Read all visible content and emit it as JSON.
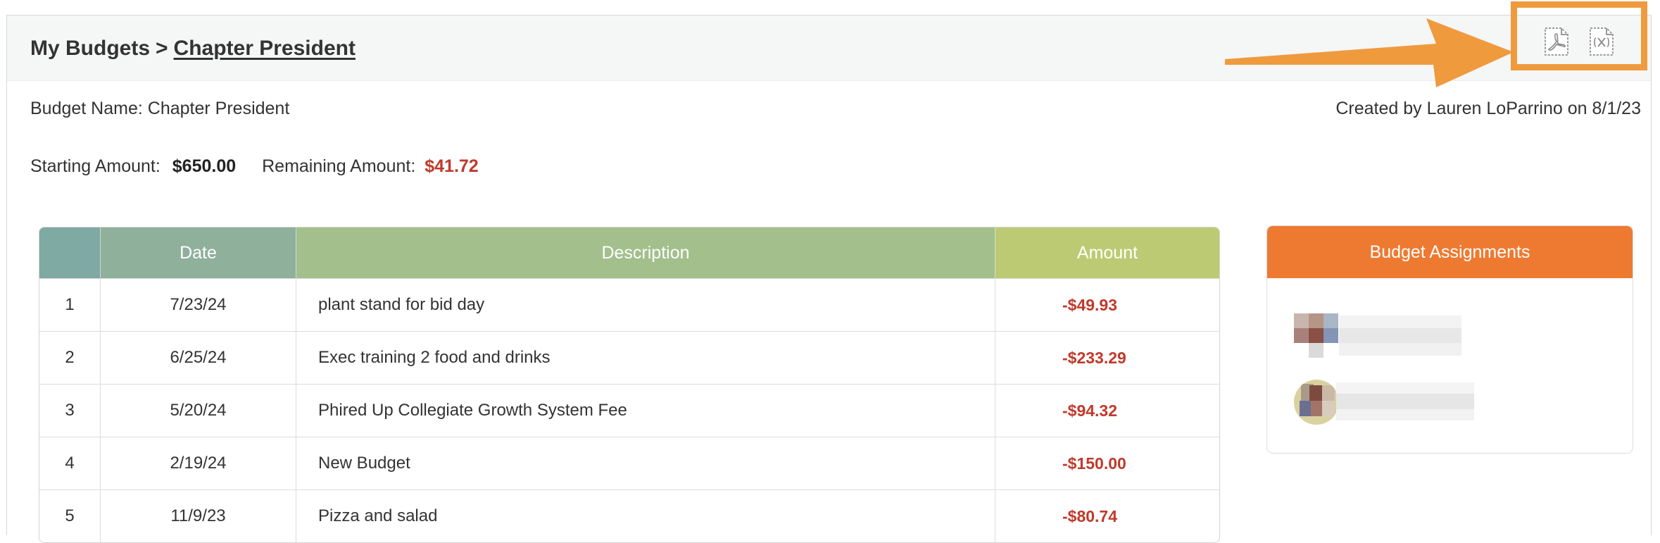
{
  "breadcrumb": {
    "root": "My Budgets",
    "separator": ">",
    "current": "Chapter President"
  },
  "export": {
    "pdf_icon": "pdf-file-icon",
    "excel_icon": "excel-file-icon",
    "highlight_color": "#f09a3e"
  },
  "budget": {
    "name_label": "Budget Name:",
    "name_value": "Chapter President",
    "created_by": "Created by Lauren LoParrino on 8/1/23",
    "starting_label": "Starting Amount:",
    "starting_value": "$650.00",
    "remaining_label": "Remaining Amount:",
    "remaining_value": "$41.72"
  },
  "table": {
    "headers": [
      "",
      "Date",
      "Description",
      "Amount"
    ],
    "rows": [
      {
        "num": "1",
        "date": "7/23/24",
        "description": "plant stand for bid day",
        "amount": "-$49.93"
      },
      {
        "num": "2",
        "date": "6/25/24",
        "description": "Exec training 2 food and drinks",
        "amount": "-$233.29"
      },
      {
        "num": "3",
        "date": "5/20/24",
        "description": "Phired Up Collegiate Growth System Fee",
        "amount": "-$94.32"
      },
      {
        "num": "4",
        "date": "2/19/24",
        "description": "New Budget",
        "amount": "-$150.00"
      },
      {
        "num": "5",
        "date": "11/9/23",
        "description": "Pizza and salad",
        "amount": "-$80.74"
      }
    ]
  },
  "assignments": {
    "title": "Budget Assignments",
    "accent_color": "#ee7a32"
  },
  "colors": {
    "negative": "#c0392b",
    "header_num": "#7fa9a3",
    "header_date": "#8fb09b",
    "header_desc": "#a3bf8c",
    "header_amount": "#bccb73"
  }
}
